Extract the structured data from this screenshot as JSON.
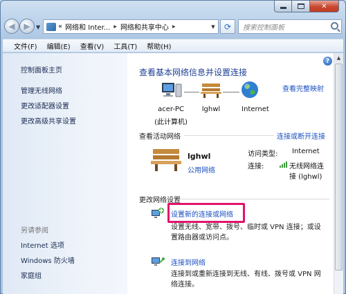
{
  "window": {
    "title_controls": {
      "minimize": "minimize",
      "maximize": "maximize",
      "close": "✕"
    }
  },
  "address_bar": {
    "prefix": "«",
    "crumbs": [
      "网络和 Inter...",
      "网络和共享中心"
    ],
    "separator": "▸",
    "refresh_icon": "refresh-icon",
    "search_placeholder": "搜索控制面板"
  },
  "menu": {
    "items": [
      "文件(F)",
      "编辑(E)",
      "查看(V)",
      "工具(T)",
      "帮助(H)"
    ]
  },
  "sidebar": {
    "home": "控制面板主页",
    "links": [
      "管理无线网络",
      "更改适配器设置",
      "更改高级共享设置"
    ],
    "see_also_heading": "另请参阅",
    "see_also": [
      "Internet 选项",
      "Windows 防火墙",
      "家庭组"
    ]
  },
  "main": {
    "help": "?",
    "title": "查看基本网络信息并设置连接",
    "full_map_link": "查看完整映射",
    "map": {
      "computer": {
        "name": "acer-PC",
        "sub": "(此计算机)"
      },
      "network": {
        "name": "lghwl"
      },
      "internet": {
        "name": "Internet"
      }
    },
    "active_networks": {
      "heading": "查看活动网络",
      "connect_link": "连接或断开连接",
      "network_name": "lghwl",
      "network_type": "公用网络",
      "access_type_label": "访问类型:",
      "access_type_value": "Internet",
      "connection_label": "连接:",
      "connection_value_line1": "无线网络连",
      "connection_value_line2": "接 (lghwl)"
    },
    "change_settings": {
      "heading": "更改网络设置",
      "tasks": [
        {
          "title": "设置新的连接或网络",
          "desc_line1": "设置无线、宽带、拨号、临时或 VPN 连接；或设",
          "desc_line2": "置路由器或访问点。"
        },
        {
          "title": "连接到网络",
          "desc_line1": "连接到或重新连接到无线、有线、拨号或 VPN 网",
          "desc_line2": "络连接。"
        }
      ]
    }
  },
  "colors": {
    "link": "#1a4fc0",
    "title": "#1c3f94",
    "highlight": "#e2136b",
    "close_button": "#c6472f"
  }
}
